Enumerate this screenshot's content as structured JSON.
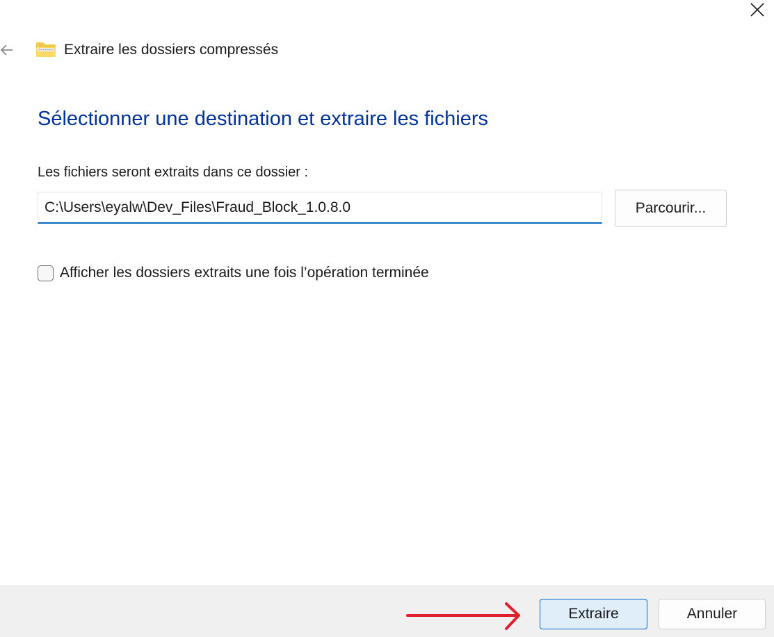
{
  "window": {
    "title": "Extraire les dossiers compressés",
    "close_icon": "close-icon",
    "back_icon": "back-arrow-icon",
    "folder_icon": "zip-folder-icon"
  },
  "main": {
    "heading": "Sélectionner une destination et extraire les fichiers",
    "field_label": "Les fichiers seront extraits dans ce dossier :",
    "path_value": "C:\\Users\\eyalw\\Dev_Files\\Fraud_Block_1.0.8.0",
    "browse_label": "Parcourir...",
    "checkbox_label": "Afficher les dossiers extraits une fois l’opération terminée",
    "checkbox_checked": false
  },
  "footer": {
    "extract_label": "Extraire",
    "cancel_label": "Annuler"
  },
  "annotation": {
    "arrow_icon": "red-arrow-icon",
    "color": "#e0202e"
  },
  "colors": {
    "heading": "#003399",
    "accent": "#0067c0",
    "footer_bg": "#f0f0f0"
  }
}
